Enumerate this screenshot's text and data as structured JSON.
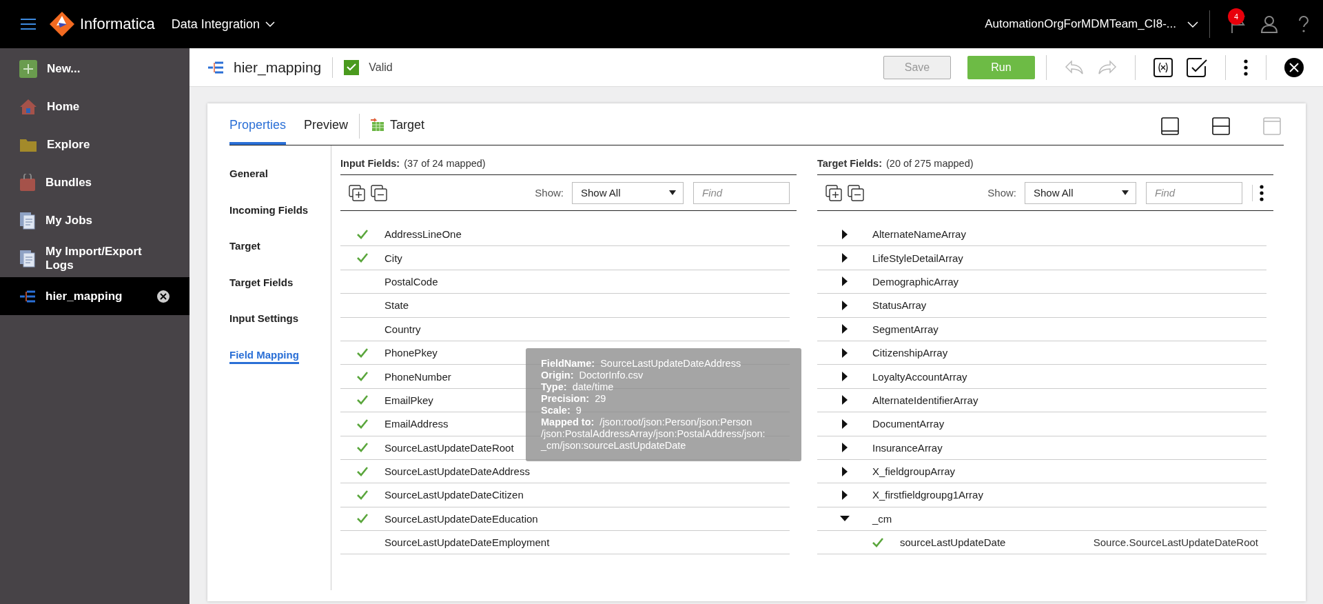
{
  "topbar": {
    "brand": "Informatica",
    "product": "Data Integration",
    "org": "AutomationOrgForMDMTeam_CI8-...",
    "notifications": "4"
  },
  "sidebar": {
    "items": [
      {
        "label": "New...",
        "kind": "new",
        "selected": false
      },
      {
        "label": "Home",
        "kind": "home",
        "selected": false
      },
      {
        "label": "Explore",
        "kind": "folder",
        "selected": false
      },
      {
        "label": "Bundles",
        "kind": "bundle",
        "selected": false
      },
      {
        "label": "My Jobs",
        "kind": "doc",
        "selected": false
      },
      {
        "label": "My Import/Export Logs",
        "kind": "doc",
        "selected": false
      },
      {
        "label": "hier_mapping",
        "kind": "mapping",
        "selected": true
      }
    ]
  },
  "toolbar": {
    "title": "hier_mapping",
    "valid": {
      "label": "Valid",
      "checked": true
    },
    "buttons": [
      {
        "label": "Save",
        "kind": "secondary",
        "disabled": true
      },
      {
        "label": "Run",
        "kind": "primary",
        "disabled": false
      }
    ]
  },
  "tabs": [
    {
      "label": "Properties",
      "selected": true
    },
    {
      "label": "Preview",
      "selected": false
    },
    {
      "label": "Target",
      "selected": false
    }
  ],
  "nav": [
    {
      "label": "General",
      "selected": false
    },
    {
      "label": "Incoming Fields",
      "selected": false
    },
    {
      "label": "Target",
      "selected": false
    },
    {
      "label": "Target Fields",
      "selected": false
    },
    {
      "label": "Input Settings",
      "selected": false
    },
    {
      "label": "Field Mapping",
      "selected": true
    }
  ],
  "input_fields": {
    "title": "Input Fields:",
    "count": "(37 of 24 mapped)",
    "show_label": "Show:",
    "show_value": "Show All",
    "find_placeholder": "Find",
    "rows": [
      {
        "name": "AddressLineOne",
        "mapped": true
      },
      {
        "name": "City",
        "mapped": true
      },
      {
        "name": "PostalCode",
        "mapped": false
      },
      {
        "name": "State",
        "mapped": false
      },
      {
        "name": "Country",
        "mapped": false
      },
      {
        "name": "PhonePkey",
        "mapped": true
      },
      {
        "name": "PhoneNumber",
        "mapped": true
      },
      {
        "name": "EmailPkey",
        "mapped": true
      },
      {
        "name": "EmailAddress",
        "mapped": true
      },
      {
        "name": "SourceLastUpdateDateRoot",
        "mapped": true
      },
      {
        "name": "SourceLastUpdateDateAddress",
        "mapped": true
      },
      {
        "name": "SourceLastUpdateDateCitizen",
        "mapped": true
      },
      {
        "name": "SourceLastUpdateDateEducation",
        "mapped": true
      },
      {
        "name": "SourceLastUpdateDateEmployment",
        "mapped": false
      }
    ]
  },
  "target_fields": {
    "title": "Target Fields:",
    "count": "(20 of 275 mapped)",
    "show_label": "Show:",
    "show_value": "Show All",
    "find_placeholder": "Find",
    "rows": [
      {
        "name": "AlternateNameArray",
        "expanded": false
      },
      {
        "name": "LifeStyleDetailArray",
        "expanded": false
      },
      {
        "name": "DemographicArray",
        "expanded": false
      },
      {
        "name": "StatusArray",
        "expanded": false
      },
      {
        "name": "SegmentArray",
        "expanded": false
      },
      {
        "name": "CitizenshipArray",
        "expanded": false
      },
      {
        "name": "LoyaltyAccountArray",
        "expanded": false
      },
      {
        "name": "AlternateIdentifierArray",
        "expanded": false
      },
      {
        "name": "DocumentArray",
        "expanded": false
      },
      {
        "name": "InsuranceArray",
        "expanded": false
      },
      {
        "name": "X_fieldgroupArray",
        "expanded": false
      },
      {
        "name": "X_firstfieldgroupg1Array",
        "expanded": false
      },
      {
        "name": "_cm",
        "expanded": true,
        "children": [
          {
            "name": "sourceLastUpdateDate",
            "mapped": true,
            "source": "Source.SourceLastUpdateDateRoot"
          }
        ]
      }
    ]
  },
  "tooltip": [
    {
      "label": "FieldName:",
      "value": "SourceLastUpdateDateAddress"
    },
    {
      "label": "Origin:",
      "value": "DoctorInfo.csv"
    },
    {
      "label": "Type:",
      "value": "date/time"
    },
    {
      "label": "Precision:",
      "value": "29"
    },
    {
      "label": "Scale:",
      "value": "9"
    },
    {
      "label": "Mapped to:",
      "value": "/json:root/json:Person/json:Person /json:PostalAddressArray/json:PostalAddress/json: _cm/json:sourceLastUpdateDate"
    }
  ]
}
